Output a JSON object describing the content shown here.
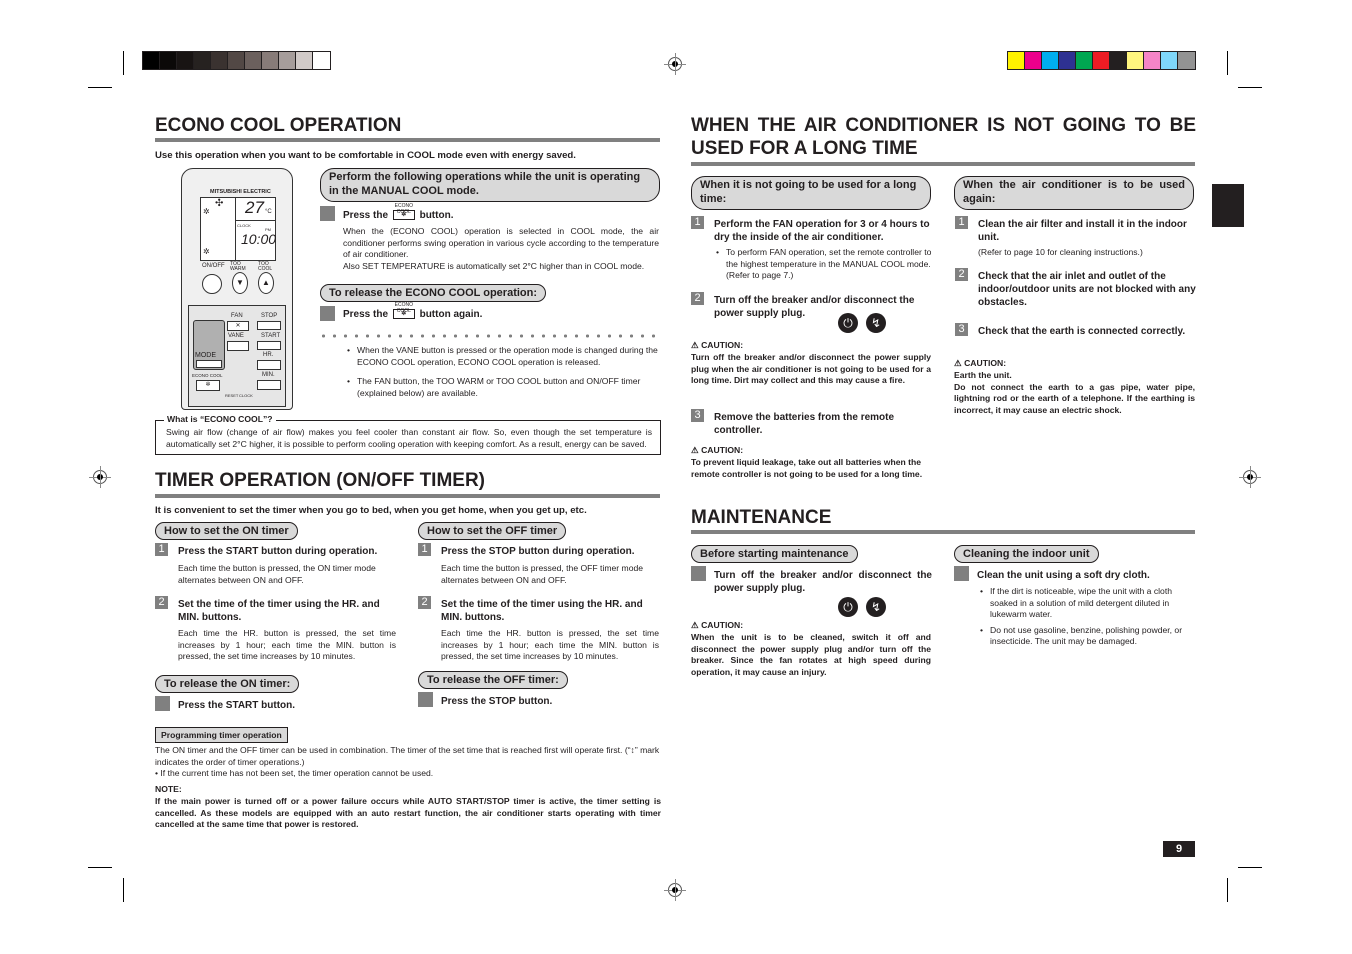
{
  "print_marks": {
    "gray_swatches": [
      "#000000",
      "#0b0908",
      "#181413",
      "#262220",
      "#3a3230",
      "#524845",
      "#6b605d",
      "#877b78",
      "#a69d9b",
      "#d1cac8",
      "#ffffff"
    ],
    "color_swatches": [
      "#fff200",
      "#ec008c",
      "#00aeef",
      "#2e3192",
      "#00a651",
      "#ed1c24",
      "#231f20",
      "#fff57f",
      "#f585c7",
      "#7fd7fa",
      "#939393"
    ]
  },
  "page_number": "9",
  "econo_cool": {
    "title": "ECONO COOL OPERATION",
    "lead": "Use this operation when you want to be comfortable in COOL mode even with energy saved.",
    "remote": {
      "brand": "MITSUBISHI ELECTRIC",
      "temp": "27",
      "temp_unit": "°C",
      "clock_label": "CLOCK",
      "time": "10:00",
      "pm": "PM",
      "on_off": "ON/OFF",
      "too_warm": "TOO WARM",
      "too_cool": "TOO COOL",
      "fan": "FAN",
      "vane": "VANE",
      "stop": "STOP",
      "start": "START",
      "mode": "MODE",
      "hr": "HR.",
      "min": "MIN.",
      "econo_cool": "ECONO COOL",
      "reset": "RESET",
      "clock": "CLOCK"
    },
    "operate_pill": "Perform the following operations while the unit is operating in the MANUAL COOL mode.",
    "press_step": {
      "prefix": "Press the",
      "button": "ECONO COOL",
      "suffix": "button."
    },
    "press_body_1": "When the (ECONO COOL) operation is selected in COOL mode, the air conditioner performs swing operation in various cycle according to the temperature of air conditioner.",
    "press_body_2": "Also SET TEMPERATURE is automatically set 2°C higher than in COOL mode.",
    "release_pill": "To release the ECONO COOL operation:",
    "release_step": {
      "prefix": "Press the",
      "button": "ECONO COOL",
      "suffix": "button again."
    },
    "notes": [
      "When the VANE button is pressed or the operation mode is changed during the ECONO COOL operation, ECONO COOL operation is released.",
      "The FAN button, the TOO WARM or TOO COOL button and ON/OFF timer (explained below) are available."
    ],
    "what_is_title": "What is “ECONO COOL”?",
    "what_is_body": "Swing air flow (change of air flow) makes you feel cooler than constant air flow. So, even though the set temperature is automatically set 2°C higher, it is possible to perform cooling operation with keeping comfort. As a result, energy can be saved."
  },
  "timer": {
    "title": "TIMER OPERATION (ON/OFF TIMER)",
    "lead": "It is convenient to set the timer when you go to bed, when you get home, when you get up, etc.",
    "on": {
      "pill": "How to set the ON timer",
      "step1": "Press the START button during operation.",
      "step1_body": "Each time the button is pressed, the ON timer mode alternates between ON and OFF.",
      "step2": "Set the time of the timer using the HR. and MIN. buttons.",
      "step2_body": "Each time the HR. button is pressed, the set time increases by 1 hour; each time the MIN. button is pressed, the set time increases by 10 minutes.",
      "release_pill": "To release the ON timer:",
      "release_step": "Press the START button."
    },
    "off": {
      "pill": "How to set the OFF timer",
      "step1": "Press the STOP button during operation.",
      "step1_body": "Each time the button is pressed, the OFF timer mode alternates between ON and OFF.",
      "step2": "Set the time of the timer using the HR. and MIN. buttons.",
      "step2_body": "Each time the HR. button is pressed, the set time increases by 1 hour; each time the MIN. button is pressed, the set time increases by 10 minutes.",
      "release_pill": "To release the OFF timer:",
      "release_step": "Press the STOP button."
    },
    "programming_label": "Programming timer operation",
    "programming_body": "The ON timer and the OFF timer can be used in combination. The timer of the set time that is reached first will operate first. (“↕” mark indicates the order of timer operations.)",
    "programming_bullet": "If the current time has not been set, the timer operation cannot be used.",
    "note_label": "NOTE:",
    "note_body": "If the main power is turned off or a power failure occurs while AUTO START/STOP timer is active, the timer setting is cancelled. As these models are equipped with an auto restart function, the air conditioner starts operating with timer cancelled at the same time that power is restored."
  },
  "long_time": {
    "title": "WHEN THE AIR CONDITIONER IS NOT GOING TO BE USED FOR A LONG TIME",
    "not_used": {
      "pill": "When it is not going to be used for a long time:",
      "step1": "Perform the FAN operation for 3 or 4 hours to dry the inside of the air conditioner.",
      "step1_bullet": "To perform FAN operation, set the remote controller to the highest temperature in the MANUAL COOL mode. (Refer to page 7.)",
      "step2": "Turn off the breaker and/or disconnect the power supply plug.",
      "caution1_label": "CAUTION:",
      "caution1": "Turn off the breaker and/or disconnect the power supply plug when the air conditioner is not going to be used for a long time. Dirt may collect and this may cause a fire.",
      "step3": "Remove the batteries from the remote controller.",
      "caution2_label": "CAUTION:",
      "caution2": "To prevent liquid leakage, take out all batteries when the remote controller is not going to be used for a long time."
    },
    "used_again": {
      "pill": "When the air conditioner is to be used again:",
      "step1": "Clean the air filter and install it in the indoor unit.",
      "step1_note": "(Refer to page 10 for cleaning instructions.)",
      "step2": "Check that the air inlet and outlet of the indoor/outdoor units are not blocked with any obstacles.",
      "step3": "Check that the earth is connected correctly.",
      "caution_label": "CAUTION:",
      "caution_1": "Earth the unit.",
      "caution_2": "Do not connect the earth to a gas pipe, water pipe, lightning rod or the earth of a telephone. If the earthing is incorrect, it may cause an electric shock."
    }
  },
  "maintenance": {
    "title": "MAINTENANCE",
    "before": {
      "pill": "Before starting maintenance",
      "step": "Turn off the breaker and/or disconnect the power supply plug.",
      "caution_label": "CAUTION:",
      "caution": "When the unit is to be cleaned, switch it off and disconnect the power supply plug and/or turn off the breaker. Since the fan rotates at high speed during operation, it may cause an injury."
    },
    "cleaning": {
      "pill": "Cleaning the indoor unit",
      "step": "Clean the unit using a soft dry cloth.",
      "bullets": [
        "If the dirt is noticeable, wipe the unit with a cloth soaked in a solution of mild detergent diluted in lukewarm water.",
        "Do not use gasoline, benzine, polishing powder, or insecticide. The unit may be damaged."
      ]
    }
  },
  "step_numbers": [
    "1",
    "2",
    "3"
  ]
}
